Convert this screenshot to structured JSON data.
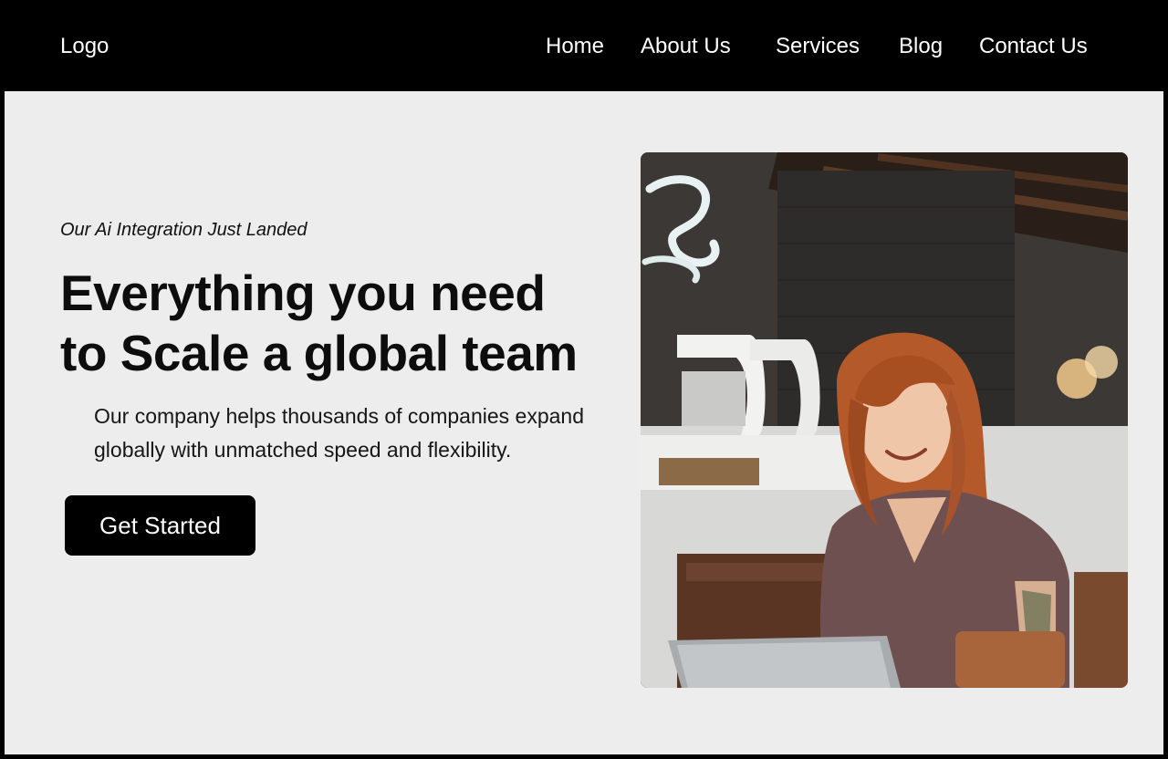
{
  "header": {
    "logo": "Logo",
    "nav": [
      "Home",
      "About Us",
      "Services",
      "Blog",
      "Contact Us"
    ]
  },
  "hero": {
    "eyebrow": "Our Ai Integration Just Landed",
    "headline_line1": "Everything you need",
    "headline_line2": "to Scale a global team",
    "description": "Our company helps thousands of companies expand globally with unmatched speed and flexibility.",
    "cta_label": "Get Started",
    "image_subject": "woman-working-on-laptop-in-cafe"
  },
  "colors": {
    "nav_background": "#000000",
    "hero_background": "#ededed",
    "cta_background": "#000000",
    "cta_text": "#ffffff"
  }
}
